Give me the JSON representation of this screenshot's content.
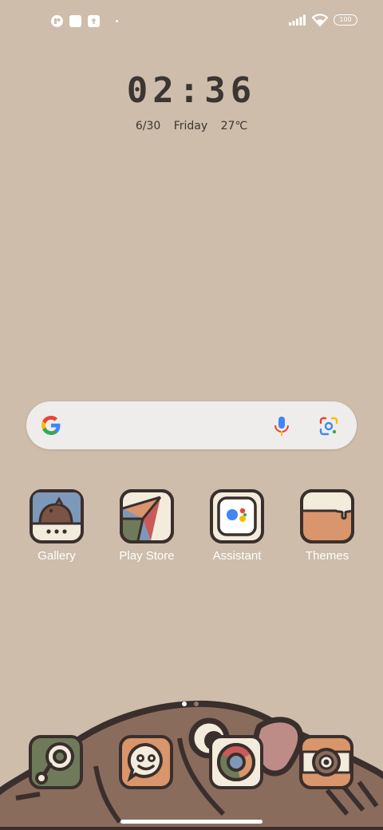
{
  "status_bar": {
    "left_icons": [
      "notification-app-icon",
      "square-notification-icon",
      "upload-notification-icon",
      "more-notifications-dot"
    ],
    "right_icons": [
      "signal-icon",
      "wifi-icon",
      "battery-icon"
    ],
    "battery_level": "100"
  },
  "clock": {
    "time": "02:36",
    "date": "6/30",
    "day": "Friday",
    "temperature": "27℃"
  },
  "search": {
    "icons": [
      "google-g-icon",
      "microphone-icon",
      "google-lens-icon"
    ]
  },
  "apps": [
    {
      "label": "Gallery",
      "icon": "gallery-icon"
    },
    {
      "label": "Play Store",
      "icon": "play-store-icon"
    },
    {
      "label": "Assistant",
      "icon": "assistant-icon"
    },
    {
      "label": "Themes",
      "icon": "themes-icon"
    }
  ],
  "page_indicator": {
    "pages": 2,
    "current": 1
  },
  "dock": [
    {
      "icon": "phone-icon"
    },
    {
      "icon": "messages-icon"
    },
    {
      "icon": "chrome-icon"
    },
    {
      "icon": "camera-icon"
    }
  ],
  "colors": {
    "wallpaper": "#cdbdaa",
    "icon_outline": "#3a2f2c",
    "icon_cream": "#f3ebdc",
    "accent_orange": "#d9956b",
    "accent_green": "#6e7a5a"
  }
}
